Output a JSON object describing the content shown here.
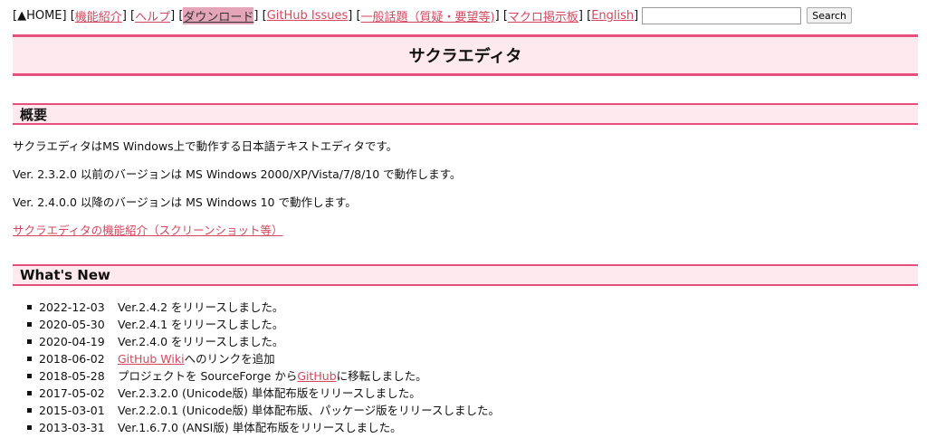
{
  "nav": {
    "home": "▲HOME",
    "items": [
      "機能紹介",
      "ヘルプ",
      "ダウンロード",
      "GitHub Issues",
      "一般話題（質疑・要望等)",
      "マクロ掲示板",
      "English"
    ],
    "search_placeholder": "",
    "search_button": "Search"
  },
  "title": "サクラエディタ",
  "overview": {
    "heading": "概要",
    "p1": "サクラエディタはMS Windows上で動作する日本語テキストエディタです。",
    "p2": "Ver. 2.3.2.0 以前のバージョンは MS Windows 2000/XP/Vista/7/8/10 で動作します。",
    "p3": "Ver. 2.4.0.0 以降のバージョンは MS Windows 10 で動作します。",
    "link": "サクラエディタの機能紹介（スクリーンショット等）"
  },
  "whatsnew": {
    "heading": "What's New",
    "items": [
      {
        "date": "2022-12-03",
        "pre": "Ver.2.4.2 をリリースしました。",
        "link": "",
        "post": ""
      },
      {
        "date": "2020-05-30",
        "pre": "Ver.2.4.1 をリリースしました。",
        "link": "",
        "post": ""
      },
      {
        "date": "2020-04-19",
        "pre": "Ver.2.4.0 をリリースしました。",
        "link": "",
        "post": ""
      },
      {
        "date": "2018-06-02",
        "pre": "",
        "link": "GitHub Wiki",
        "post": " へのリンクを追加"
      },
      {
        "date": "2018-05-28",
        "pre": "プロジェクトを SourceForge から ",
        "link": "GitHub",
        "post": " に移転しました。"
      },
      {
        "date": "2017-05-02",
        "pre": "Ver.2.3.2.0 (Unicode版) 単体配布版をリリースしました。",
        "link": "",
        "post": ""
      },
      {
        "date": "2015-03-01",
        "pre": "Ver.2.2.0.1 (Unicode版) 単体配布版、パッケージ版をリリースしました。",
        "link": "",
        "post": ""
      },
      {
        "date": "2013-03-31",
        "pre": "Ver.1.6.7.0 (ANSI版) 単体配布版をリリースしました。",
        "link": "",
        "post": ""
      }
    ]
  }
}
